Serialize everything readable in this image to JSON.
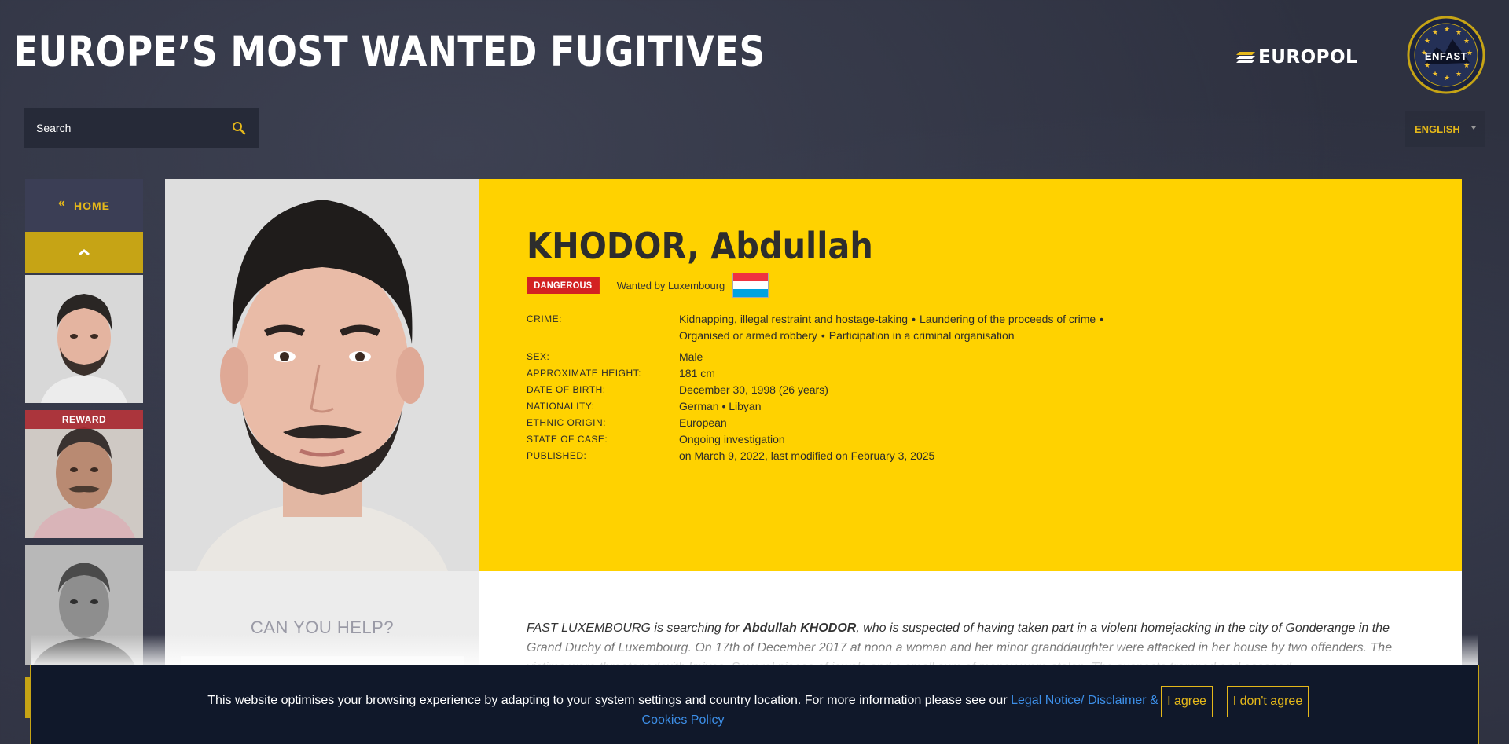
{
  "header": {
    "title": "EUROPE’S MOST WANTED FUGITIVES",
    "europol_logo": "EUROPOL",
    "enfast_logo": "ENFAST"
  },
  "search": {
    "placeholder": "Search",
    "icon": "search-icon"
  },
  "language": {
    "selected": "ENGLISH"
  },
  "sidebar": {
    "home_label": "HOME",
    "home_icon": "double-chevron-left-icon",
    "up_icon": "chevron-up-icon",
    "thumbnails": [
      {
        "badge": ""
      },
      {
        "badge": "REWARD"
      },
      {
        "badge": ""
      }
    ]
  },
  "profile": {
    "name": "KHODOR, Abdullah",
    "badge": "DANGEROUS",
    "wanted_by": "Wanted by Luxembourg",
    "flag_colors": [
      "#ef3340",
      "#ffffff",
      "#00a3e0"
    ],
    "fields": {
      "crime": {
        "label": "CRIME:",
        "items": [
          "Kidnapping, illegal restraint and hostage-taking",
          "Laundering of the proceeds of crime",
          "Organised or armed robbery",
          "Participation in a criminal organisation"
        ]
      },
      "sex": {
        "label": "SEX:",
        "value": "Male"
      },
      "height": {
        "label": "APPROXIMATE HEIGHT:",
        "value": "181 cm"
      },
      "dob": {
        "label": "DATE OF BIRTH:",
        "value": "December 30, 1998 (26 years)"
      },
      "nationality": {
        "label": "NATIONALITY:",
        "value": "German • Libyan"
      },
      "ethnic": {
        "label": "ETHNIC ORIGIN:",
        "value": "European"
      },
      "state": {
        "label": "STATE OF CASE:",
        "value": "Ongoing investigation"
      },
      "published": {
        "label": "PUBLISHED:",
        "value": "on March 9, 2022, last modified on February 3, 2025"
      }
    }
  },
  "help": {
    "title": "CAN YOU HELP?"
  },
  "description": {
    "part1": "FAST LUXEMBOURG is searching for ",
    "name": "Abdullah KHODOR",
    "part2": ", who is suspected of having taken part in a violent homejacking in the city of Gonderange in the Grand Duchy of Luxembourg. On 17th of December 2017 at noon a woman and her minor granddaughter were attacked in her house by two offenders. The victims were threatened with knives. Several pieces of jewels and a small sum of money were stolen. The suspects tramped and escaped."
  },
  "cookie": {
    "text": "This website optimises your browsing experience by adapting to your system settings and country location. For more information please see our ",
    "link": "Legal Notice/ Disclaimer & Cookies Policy",
    "agree": "I agree",
    "disagree": "I don't agree"
  },
  "colors": {
    "accent": "#ffd200",
    "gold": "#e5b81a",
    "danger": "#d32222",
    "link": "#3d8fe8"
  }
}
